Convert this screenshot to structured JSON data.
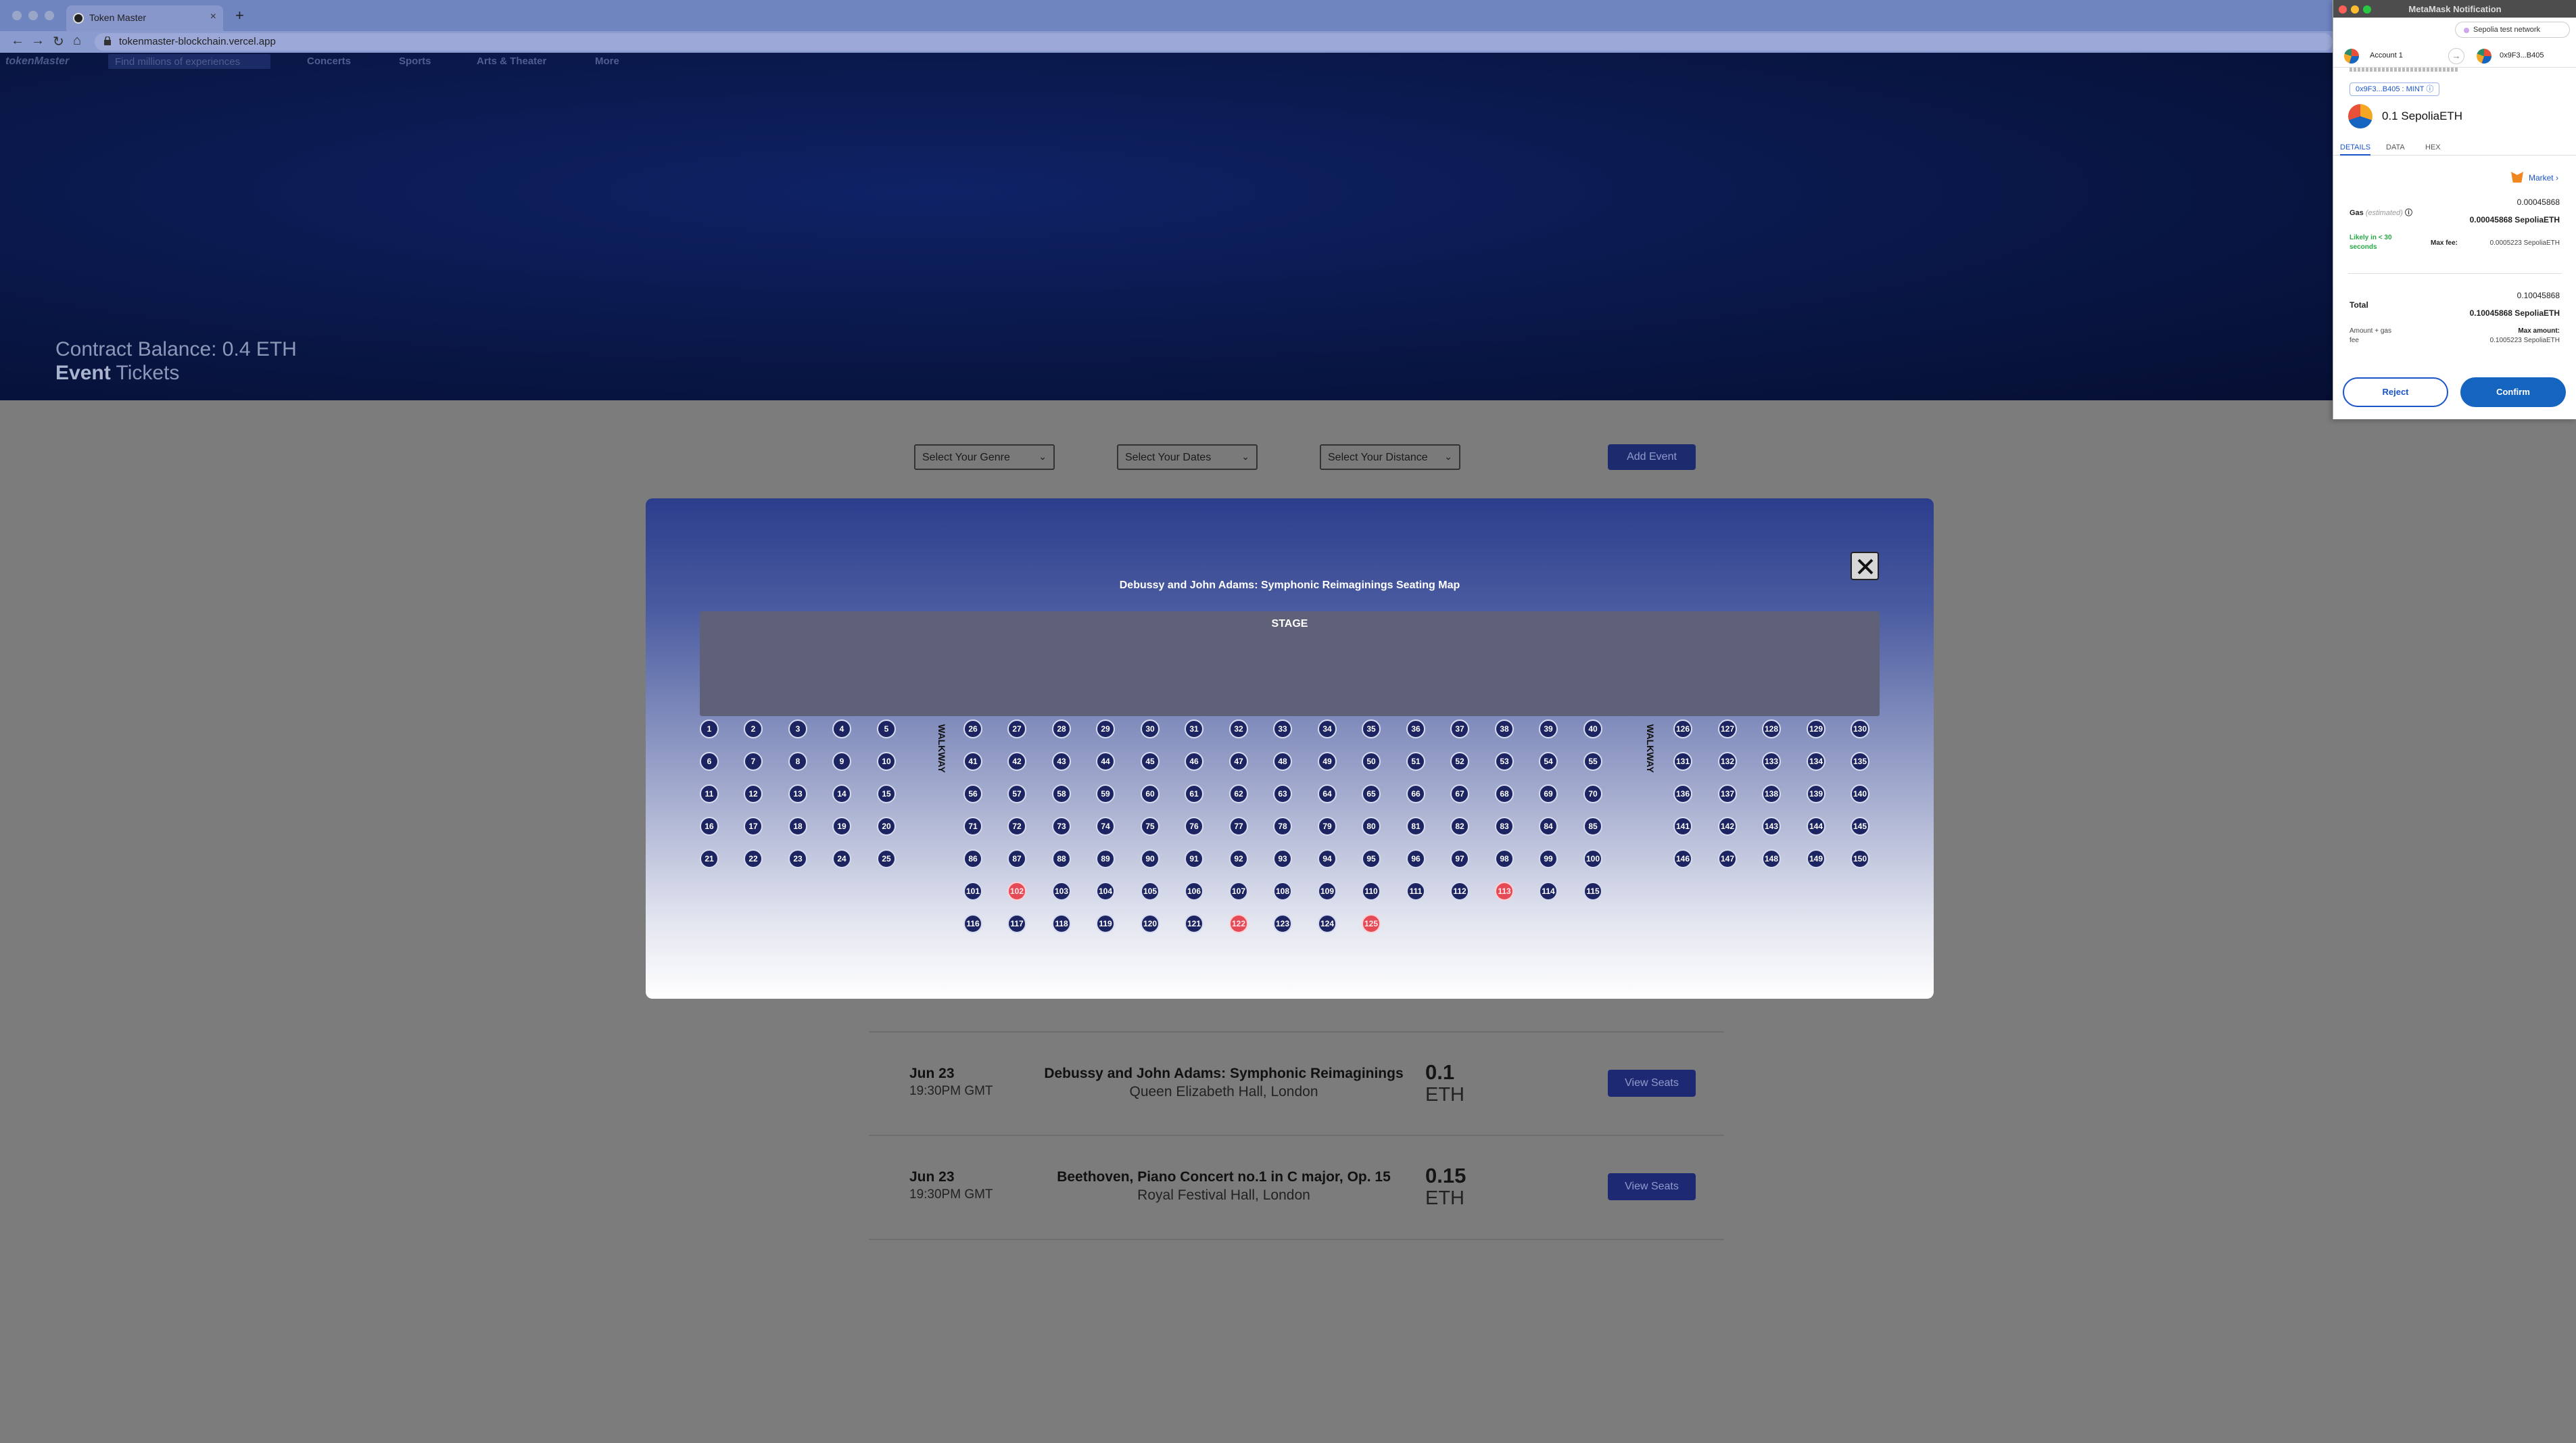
{
  "browser": {
    "tab_title": "Token Master",
    "new_tab": "+",
    "url": "tokenmaster-blockchain.vercel.app"
  },
  "site": {
    "logo": "tokenMaster",
    "search_placeholder": "Find millions of experiences",
    "nav": [
      "Concerts",
      "Sports",
      "Arts & Theater",
      "More"
    ],
    "contract_balance": "Contract Balance: 0.4 ETH",
    "event_word": "Event",
    "tickets_word": " Tickets",
    "filters": {
      "genre": "Select Your Genre",
      "dates": "Select Your Dates",
      "distance": "Select Your Distance",
      "add_event": "Add Event"
    }
  },
  "events": [
    {
      "date": "Jun 23",
      "time": "19:30PM GMT",
      "name": "Debussy and John Adams: Symphonic Reimaginings",
      "venue": "Queen Elizabeth Hall, London",
      "price": "0.1",
      "unit": "ETH",
      "button": "View Seats"
    },
    {
      "date": "Jun 23",
      "time": "19:30PM GMT",
      "name": "Beethoven, Piano Concert no.1 in C major, Op. 15",
      "venue": "Royal Festival Hall, London",
      "price": "0.15",
      "unit": "ETH",
      "button": "View Seats"
    }
  ],
  "seating": {
    "title": "Debussy and John Adams: Symphonic Reimaginings Seating Map",
    "stage": "STAGE",
    "walkway": "WALKWAY",
    "total_seats": 150,
    "taken_seats": [
      102,
      113,
      122,
      125
    ]
  },
  "metamask": {
    "window_title": "MetaMask Notification",
    "network": "Sepolia test network",
    "from_account": "Account 1",
    "to_account": "0x9F3...B405",
    "contract_method": "0x9F3...B405 : MINT",
    "amount": "0.1 SepoliaETH",
    "tabs": [
      "DETAILS",
      "DATA",
      "HEX"
    ],
    "market": "Market",
    "gas_label": "Gas",
    "gas_estimated": "(estimated)",
    "gas_value": "0.00045868",
    "gas_value_eth": "0.00045868 SepoliaETH",
    "likely_line1": "Likely in < 30",
    "likely_line2": "seconds",
    "max_fee_label": "Max fee:",
    "max_fee_value": "0.0005223 SepoliaETH",
    "total_label": "Total",
    "total_value": "0.10045868",
    "total_value_eth": "0.10045868 SepoliaETH",
    "amount_gas_line1": "Amount + gas",
    "amount_gas_line2": "fee",
    "max_amount_label": "Max amount:",
    "max_amount_value": "0.1005223 SepoliaETH",
    "reject": "Reject",
    "confirm": "Confirm"
  },
  "colors": {
    "seat_available": "#1c2561",
    "seat_taken": "#e44b57",
    "primary_button": "#1565c0"
  }
}
